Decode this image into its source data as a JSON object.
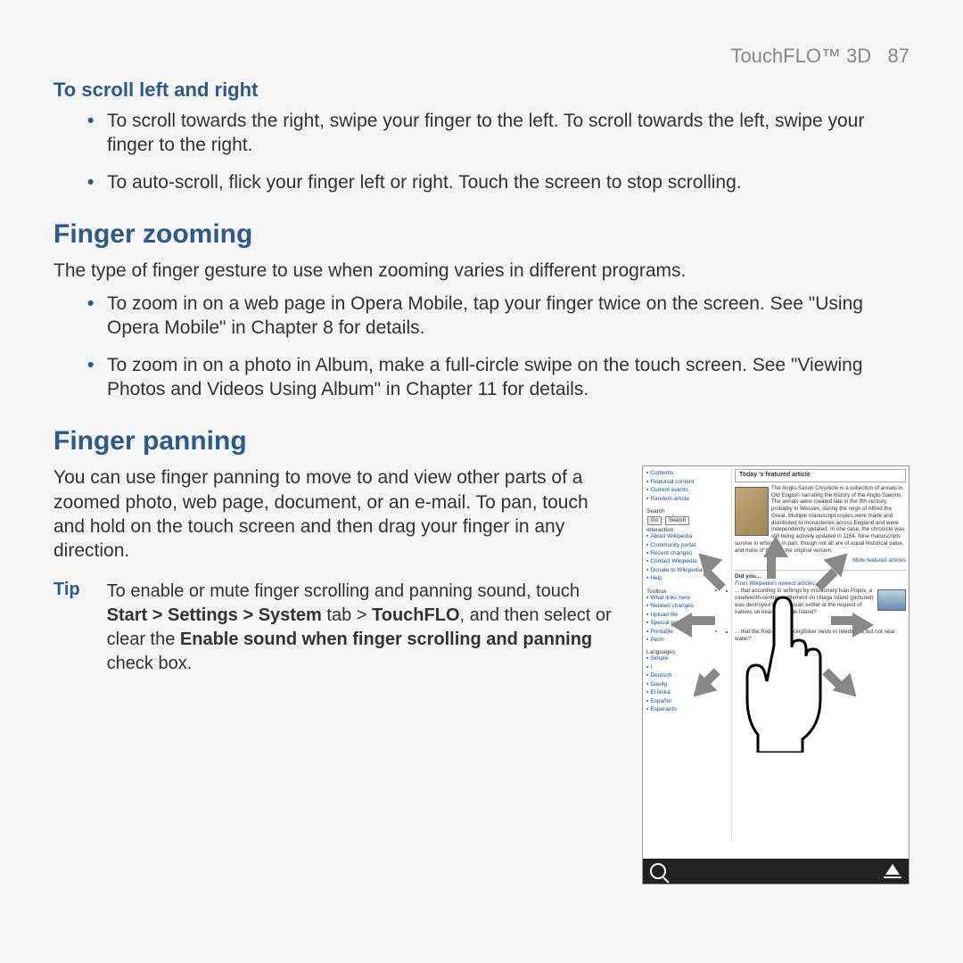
{
  "header": {
    "product": "TouchFLO™ 3D",
    "page": "87"
  },
  "scroll": {
    "heading": "To scroll left and right",
    "bullets": [
      "To scroll towards the right, swipe your finger to the left. To scroll towards the left, swipe your finger to the right.",
      "To auto-scroll, flick your finger left or right. Touch the screen to stop scrolling."
    ]
  },
  "zoom": {
    "heading": "Finger zooming",
    "intro": "The type of finger gesture to use when zooming varies in different programs.",
    "bullets": [
      "To zoom in on a web page in Opera Mobile, tap your finger twice on the screen. See \"Using Opera Mobile\" in Chapter 8 for details.",
      "To zoom in on a photo in Album, make a full-circle swipe on the touch screen. See \"Viewing Photos and Videos Using Album\" in Chapter 11 for details."
    ]
  },
  "panning": {
    "heading": "Finger panning",
    "intro": "You can use finger panning to move to and view other parts of a zoomed photo, web page, document, or an e-mail. To pan, touch and hold on the touch screen and then drag your finger in any direction.",
    "tip_label": "Tip",
    "tip_pre": "To enable or mute finger scrolling and panning sound, touch ",
    "tip_bold1": "Start > Settings > System",
    "tip_mid1": " tab > ",
    "tip_bold2": "TouchFLO",
    "tip_mid2": ", and then select or clear the ",
    "tip_bold3": "Enable sound when finger scrolling and panning",
    "tip_post": " check box."
  },
  "screenshot": {
    "article_title": "Today 's featured  article",
    "nav_sections": {
      "top": [
        "Contents",
        "Featured content",
        "Current events",
        "Random article"
      ],
      "search_label": "Search",
      "go_btn": "Go",
      "search_btn": "Search",
      "interaction_label": "Interaction",
      "interaction": [
        "About Wikipedia",
        "Community portal",
        "Recent changes",
        "Contact Wikipedia",
        "Donate to Wikipedia",
        "Help"
      ],
      "toolbox_label": "Toolbox",
      "toolbox": [
        "What links here",
        "Related changes",
        "Upload file",
        "Special pages",
        "Printable",
        "Perm"
      ],
      "languages_label": "Languages",
      "languages": [
        "Simple",
        "ا",
        "Deutsch",
        "Gaeilg",
        "El.liniká",
        "Español",
        "Esperanto"
      ]
    },
    "featured": "The Anglo-Saxon Chronicle is a collection of annals in Old English narrating the history of the Anglo-Saxons. The annals were created late in the 9th century, probably in Wessex, during the reign of Alfred the Great. Multiple manuscript copies were made and distributed to monasteries across England and were independently updated. In one case, the chronicle was still being actively updated in 1154. Nine manuscripts survive in whole or in part, though not all are of equal historical value, and none of them is the original version.",
    "dyk_label": "Did you...",
    "newest_label": "From Wikipedia's newest articles:",
    "newest_items": [
      "... that according to writings by missionary Ivan Popov, a nineteenth-century settlement on Uliaga Island (pictured) was destroyed by a Russian settler at the request of natives on nearby Umnak Island?",
      "... that the Red-backed Kingfisher nests in riverbanks but not near water?"
    ],
    "more_featured": "More featured articles"
  }
}
